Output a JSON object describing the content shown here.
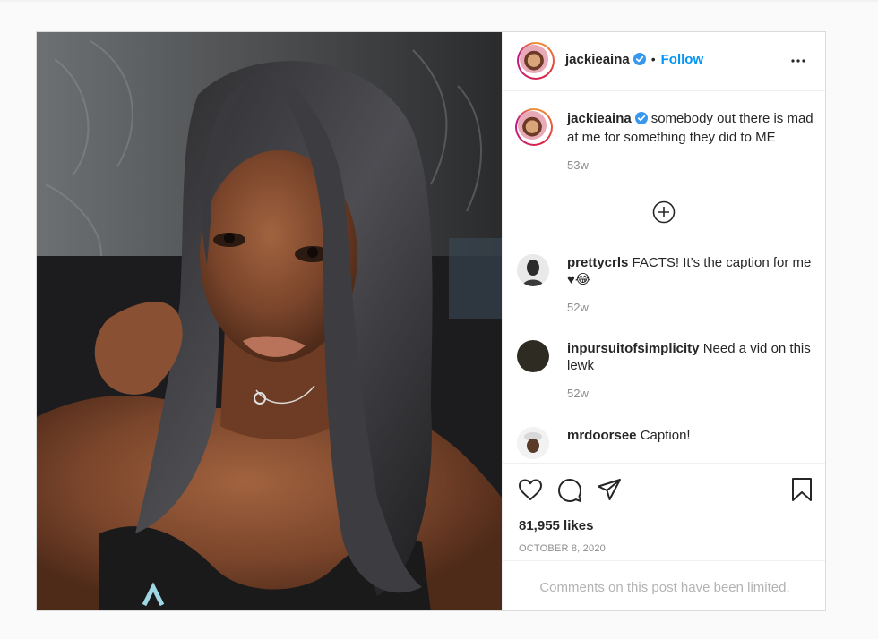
{
  "post": {
    "author": {
      "username": "jackieaina",
      "follow_label": "Follow",
      "separator": "•"
    },
    "caption": {
      "username": "jackieaina",
      "text": "somebody out there is mad at me for something they did to ME",
      "time": "53w"
    },
    "comments": [
      {
        "username": "prettycrls",
        "text": "FACTS! It’s the caption for me ♥😂",
        "time": "52w"
      },
      {
        "username": "inpursuitofsimplicity",
        "text": "Need a vid on this lewk",
        "time": "52w"
      },
      {
        "username": "mrdoorsee",
        "text": "Caption!",
        "time": ""
      }
    ],
    "likes": "81,955 likes",
    "date": "OCTOBER 8, 2020",
    "comments_limited": "Comments on this post have been limited."
  },
  "colors": {
    "follow_blue": "#0095f6",
    "verified_blue": "#3897f0",
    "text": "#262626",
    "muted": "#8e8e8e"
  },
  "icons": [
    "verified-icon",
    "more-options-icon",
    "load-more-comments-icon",
    "heart-icon",
    "comment-icon",
    "share-icon",
    "bookmark-icon"
  ]
}
